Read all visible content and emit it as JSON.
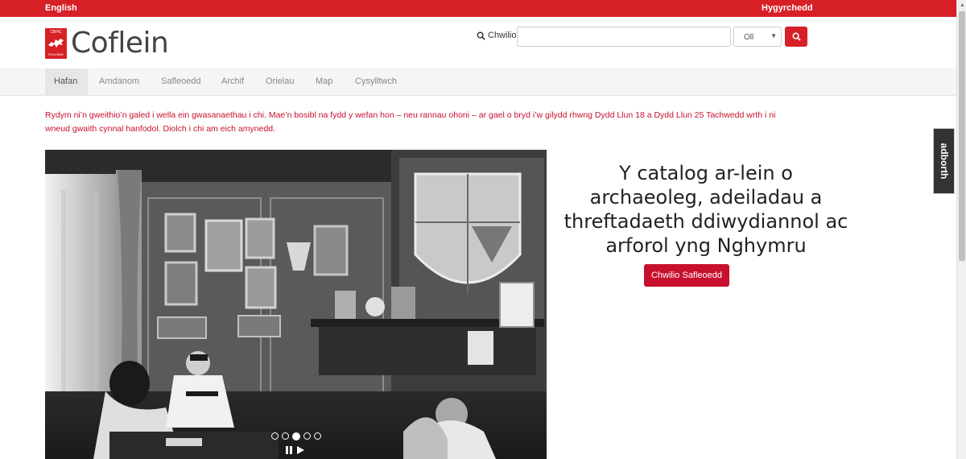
{
  "topbar": {
    "language_link": "English",
    "accessibility_link": "Hygyrchedd"
  },
  "logo": {
    "badge_top": "CBHC",
    "badge_bottom": "RCAHMW",
    "name": "Coflein"
  },
  "search": {
    "label": "Chwilio",
    "input_value": "",
    "scope_value": "Oll"
  },
  "nav": {
    "items": [
      "Hafan",
      "Amdanom",
      "Safleoedd",
      "Archif",
      "Orielau",
      "Map",
      "Cysylltwch"
    ],
    "active": "Hafan"
  },
  "notice": "Rydym ni’n gweithio’n galed i wella ein gwasanaethau i chi. Mae’n bosibl na fydd y wefan hon – neu rannau ohoni – ar gael o bryd i’w gilydd rhwng Dydd Llun 18 a Dydd Llun 25 Tachwedd wrth i ni wneud gwaith cynnal hanfodol. Diolch i chi am eich amynedd.",
  "hero": {
    "slide_count": 5,
    "active_slide": 3
  },
  "tagline": "Y catalog ar-lein o archaeoleg, adeiladau a threftadaeth ddiwydiannol ac arforol yng Nghymru",
  "cta_label": "Chwilio Safleoedd",
  "feedback_tab": "adborth",
  "colors": {
    "brand_red": "#d71f26",
    "notice_red": "#c8102e"
  }
}
